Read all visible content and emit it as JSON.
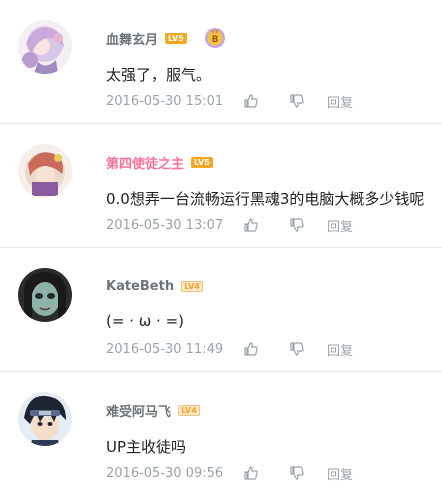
{
  "comments": [
    {
      "username": "血舞玄月",
      "level": "LV5",
      "has_medal": true,
      "medal_letter": "B",
      "text": "太强了，服气。",
      "time": "2016-05-30 15:01",
      "reply_label": "回复"
    },
    {
      "username": "第四使徒之主",
      "level": "LV5",
      "has_medal": false,
      "text": "0.0想弄一台流畅运行黑魂3的电脑大概多少钱呢",
      "time": "2016-05-30 13:07",
      "reply_label": "回复"
    },
    {
      "username": "KateBeth",
      "level": "LV4",
      "has_medal": false,
      "text": "(= · ω · =)",
      "time": "2016-05-30 11:49",
      "reply_label": "回复"
    },
    {
      "username": "难受阿马飞",
      "level": "LV4",
      "has_medal": false,
      "text": "UP主收徒吗",
      "time": "2016-05-30 09:56",
      "reply_label": "回复"
    }
  ]
}
